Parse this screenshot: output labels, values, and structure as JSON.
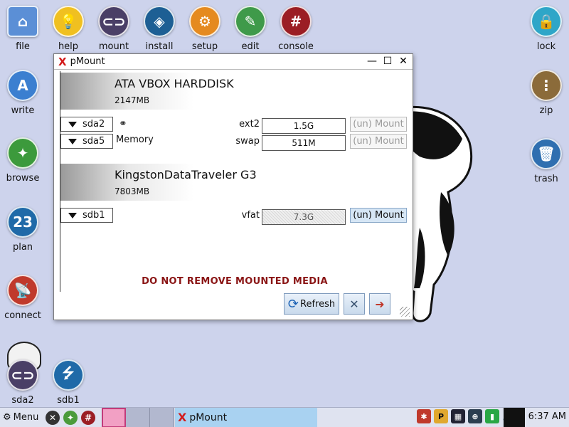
{
  "desktop": {
    "top_icons": [
      {
        "label": "file",
        "icon": "folder-home-icon"
      },
      {
        "label": "help",
        "icon": "lightbulb-icon"
      },
      {
        "label": "mount",
        "icon": "toggle-icon"
      },
      {
        "label": "install",
        "icon": "dropbox-icon"
      },
      {
        "label": "setup",
        "icon": "gear-icon"
      },
      {
        "label": "edit",
        "icon": "pencil-icon"
      },
      {
        "label": "console",
        "icon": "terminal-icon"
      }
    ],
    "left_icons": [
      {
        "label": "write",
        "icon": "pen-icon"
      },
      {
        "label": "browse",
        "icon": "compass-icon"
      },
      {
        "label": "plan",
        "icon": "calendar-icon",
        "day": "23"
      },
      {
        "label": "connect",
        "icon": "satellite-dish-icon"
      }
    ],
    "right_icons": [
      {
        "label": "lock",
        "icon": "padlock-icon"
      },
      {
        "label": "zip",
        "icon": "zipper-icon"
      },
      {
        "label": "trash",
        "icon": "trash-icon"
      }
    ],
    "drive_icons": [
      {
        "label": "sda2",
        "icon": "drive-toggle-icon"
      },
      {
        "label": "sdb1",
        "icon": "usb-icon"
      }
    ],
    "behind_label": "connect"
  },
  "window": {
    "title": "pMount",
    "buttons": {
      "minimize": "—",
      "maximize": "☐",
      "close": "✕"
    },
    "disks": [
      {
        "name": "ATA VBOX HARDDISK",
        "size": "2147MB",
        "partitions": [
          {
            "device": "sda2",
            "fs": "ext2",
            "size": "1.5G",
            "mount_label": "(un) Mount",
            "enabled": false
          },
          {
            "device": "sda5",
            "fs": "swap",
            "size": "511M",
            "mount_label": "(un) Mount",
            "enabled": false,
            "extra": "Memory"
          }
        ]
      },
      {
        "name": "KingstonDataTraveler G3",
        "size": "7803MB",
        "partitions": [
          {
            "device": "sdb1",
            "fs": "vfat",
            "size": "7.3G",
            "mount_label": "(un) Mount",
            "enabled": true
          }
        ]
      }
    ],
    "warning": "DO NOT REMOVE MOUNTED MEDIA",
    "refresh_label": "Refresh"
  },
  "taskbar": {
    "menu_label": "Menu",
    "task_label": "pMount",
    "clock": "6:37 AM"
  },
  "colors": {
    "desktop_bg": "#cdd3ec",
    "warning": "#8a1515",
    "task_active": "#a9d2f1"
  }
}
